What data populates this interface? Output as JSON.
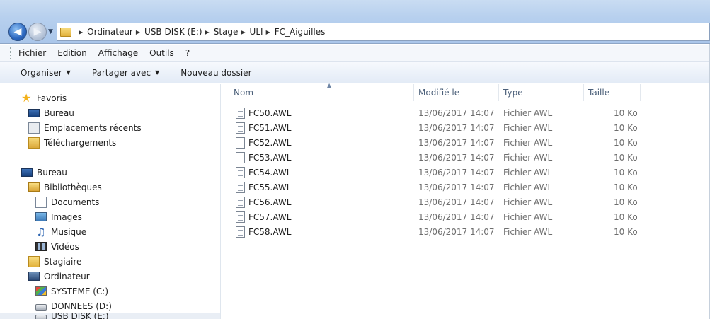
{
  "address": {
    "crumbs": [
      "Ordinateur",
      "USB DISK (E:)",
      "Stage",
      "ULI",
      "FC_Aiguilles"
    ]
  },
  "menu": {
    "items": [
      "Fichier",
      "Edition",
      "Affichage",
      "Outils",
      "?"
    ]
  },
  "commands": {
    "organize": "Organiser",
    "share": "Partager avec",
    "new_folder": "Nouveau dossier"
  },
  "nav": {
    "favorites": "Favoris",
    "desktop_fav": "Bureau",
    "recent": "Emplacements récents",
    "downloads": "Téléchargements",
    "desktop": "Bureau",
    "libraries": "Bibliothèques",
    "documents": "Documents",
    "images": "Images",
    "music": "Musique",
    "videos": "Vidéos",
    "user": "Stagiaire",
    "computer": "Ordinateur",
    "system_drive": "SYSTEME (C:)",
    "data_drive": "DONNEES (D:)",
    "usb_drive": "USB DISK (E:)"
  },
  "columns": {
    "name": "Nom",
    "modified": "Modifié le",
    "type": "Type",
    "size": "Taille"
  },
  "files": [
    {
      "name": "FC50.AWL",
      "modified": "13/06/2017 14:07",
      "type": "Fichier AWL",
      "size": "10 Ko"
    },
    {
      "name": "FC51.AWL",
      "modified": "13/06/2017 14:07",
      "type": "Fichier AWL",
      "size": "10 Ko"
    },
    {
      "name": "FC52.AWL",
      "modified": "13/06/2017 14:07",
      "type": "Fichier AWL",
      "size": "10 Ko"
    },
    {
      "name": "FC53.AWL",
      "modified": "13/06/2017 14:07",
      "type": "Fichier AWL",
      "size": "10 Ko"
    },
    {
      "name": "FC54.AWL",
      "modified": "13/06/2017 14:07",
      "type": "Fichier AWL",
      "size": "10 Ko"
    },
    {
      "name": "FC55.AWL",
      "modified": "13/06/2017 14:07",
      "type": "Fichier AWL",
      "size": "10 Ko"
    },
    {
      "name": "FC56.AWL",
      "modified": "13/06/2017 14:07",
      "type": "Fichier AWL",
      "size": "10 Ko"
    },
    {
      "name": "FC57.AWL",
      "modified": "13/06/2017 14:07",
      "type": "Fichier AWL",
      "size": "10 Ko"
    },
    {
      "name": "FC58.AWL",
      "modified": "13/06/2017 14:07",
      "type": "Fichier AWL",
      "size": "10 Ko"
    }
  ]
}
